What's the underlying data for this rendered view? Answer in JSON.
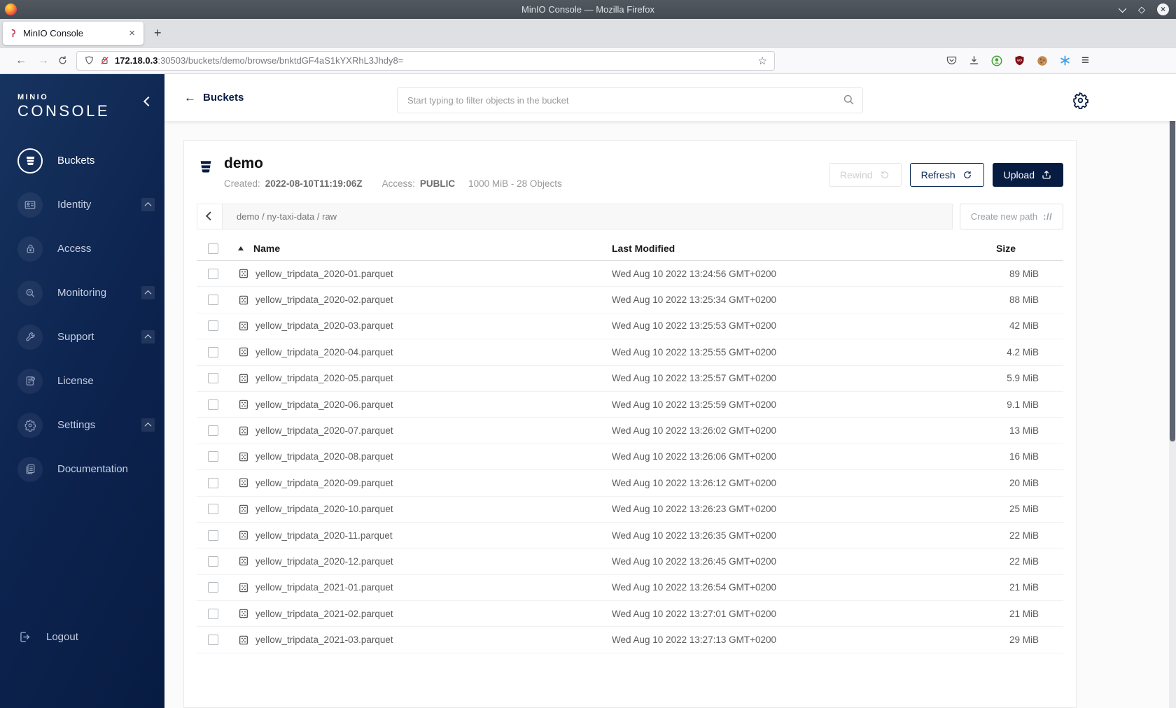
{
  "window": {
    "title": "MinIO Console — Mozilla Firefox"
  },
  "browser": {
    "tab_title": "MinIO Console",
    "url_host": "172.18.0.3",
    "url_rest": ":30503/buckets/demo/browse/bnktdGF4aS1kYXRhL3Jhdy8="
  },
  "icons": {
    "maximize": "◇",
    "close": "×",
    "tab_close": "×",
    "new_tab": "+",
    "back": "←",
    "forward": "→",
    "star": "☆",
    "menu": "≡",
    "create_path": "://"
  },
  "sidebar": {
    "logo_line1": "MINIO",
    "logo_line2": "CONSOLE",
    "items": [
      {
        "label": "Buckets",
        "icon": "buckets-icon",
        "active": true,
        "expandable": false
      },
      {
        "label": "Identity",
        "icon": "identity-icon",
        "active": false,
        "expandable": true
      },
      {
        "label": "Access",
        "icon": "access-icon",
        "active": false,
        "expandable": false
      },
      {
        "label": "Monitoring",
        "icon": "monitoring-icon",
        "active": false,
        "expandable": true
      },
      {
        "label": "Support",
        "icon": "support-icon",
        "active": false,
        "expandable": true
      },
      {
        "label": "License",
        "icon": "license-icon",
        "active": false,
        "expandable": false
      },
      {
        "label": "Settings",
        "icon": "settings-icon",
        "active": false,
        "expandable": true
      },
      {
        "label": "Documentation",
        "icon": "documentation-icon",
        "active": false,
        "expandable": false
      }
    ],
    "logout_label": "Logout"
  },
  "header": {
    "back_label": "Buckets",
    "search_placeholder": "Start typing to filter objects in the bucket"
  },
  "bucket": {
    "name": "demo",
    "created_label": "Created:",
    "created_value": "2022-08-10T11:19:06Z",
    "access_label": "Access:",
    "access_value": "PUBLIC",
    "summary": "1000 MiB - 28 Objects",
    "actions": {
      "rewind": "Rewind",
      "refresh": "Refresh",
      "upload": "Upload"
    }
  },
  "browse": {
    "breadcrumb": "demo / ny-taxi-data / raw",
    "create_path_label": "Create new path",
    "columns": {
      "name": "Name",
      "last_modified": "Last Modified",
      "size": "Size"
    },
    "rows": [
      {
        "name": "yellow_tripdata_2020-01.parquet",
        "modified": "Wed Aug 10 2022 13:24:56 GMT+0200",
        "size": "89 MiB"
      },
      {
        "name": "yellow_tripdata_2020-02.parquet",
        "modified": "Wed Aug 10 2022 13:25:34 GMT+0200",
        "size": "88 MiB"
      },
      {
        "name": "yellow_tripdata_2020-03.parquet",
        "modified": "Wed Aug 10 2022 13:25:53 GMT+0200",
        "size": "42 MiB"
      },
      {
        "name": "yellow_tripdata_2020-04.parquet",
        "modified": "Wed Aug 10 2022 13:25:55 GMT+0200",
        "size": "4.2 MiB"
      },
      {
        "name": "yellow_tripdata_2020-05.parquet",
        "modified": "Wed Aug 10 2022 13:25:57 GMT+0200",
        "size": "5.9 MiB"
      },
      {
        "name": "yellow_tripdata_2020-06.parquet",
        "modified": "Wed Aug 10 2022 13:25:59 GMT+0200",
        "size": "9.1 MiB"
      },
      {
        "name": "yellow_tripdata_2020-07.parquet",
        "modified": "Wed Aug 10 2022 13:26:02 GMT+0200",
        "size": "13 MiB"
      },
      {
        "name": "yellow_tripdata_2020-08.parquet",
        "modified": "Wed Aug 10 2022 13:26:06 GMT+0200",
        "size": "16 MiB"
      },
      {
        "name": "yellow_tripdata_2020-09.parquet",
        "modified": "Wed Aug 10 2022 13:26:12 GMT+0200",
        "size": "20 MiB"
      },
      {
        "name": "yellow_tripdata_2020-10.parquet",
        "modified": "Wed Aug 10 2022 13:26:23 GMT+0200",
        "size": "25 MiB"
      },
      {
        "name": "yellow_tripdata_2020-11.parquet",
        "modified": "Wed Aug 10 2022 13:26:35 GMT+0200",
        "size": "22 MiB"
      },
      {
        "name": "yellow_tripdata_2020-12.parquet",
        "modified": "Wed Aug 10 2022 13:26:45 GMT+0200",
        "size": "22 MiB"
      },
      {
        "name": "yellow_tripdata_2021-01.parquet",
        "modified": "Wed Aug 10 2022 13:26:54 GMT+0200",
        "size": "21 MiB"
      },
      {
        "name": "yellow_tripdata_2021-02.parquet",
        "modified": "Wed Aug 10 2022 13:27:01 GMT+0200",
        "size": "21 MiB"
      },
      {
        "name": "yellow_tripdata_2021-03.parquet",
        "modified": "Wed Aug 10 2022 13:27:13 GMT+0200",
        "size": "29 MiB"
      }
    ]
  },
  "colors": {
    "accent_navy": "#081C42",
    "sidebar_gradient_start": "#17335F",
    "sidebar_gradient_end": "#081C42",
    "titlebar": "#4B525A",
    "ublock_red": "#7D1117",
    "extension_green": "#4A9E42",
    "extension_blue": "#3B9FF0"
  }
}
